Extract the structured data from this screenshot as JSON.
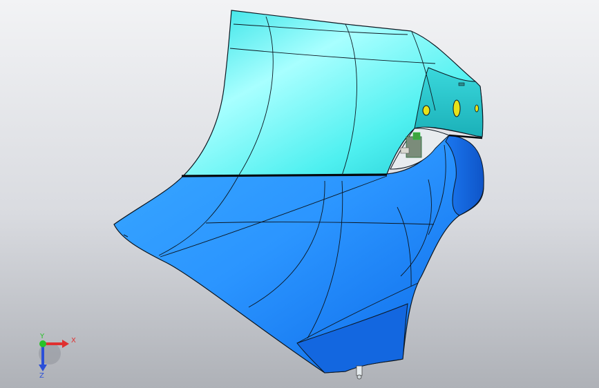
{
  "viewport": {
    "colors": {
      "upper_panel": "#35ecec",
      "lower_panel": "#1e8fff",
      "edge_lines": "#0c1620",
      "background_top": "#f2f3f5",
      "background_bottom": "#aeb1b7",
      "feature_yellow": "#e7e21a"
    }
  },
  "triad": {
    "x_label": "X",
    "y_label": "Y",
    "z_label": "Z",
    "x_color": "#e03030",
    "y_color": "#27c227",
    "z_color": "#2a4fd8"
  }
}
